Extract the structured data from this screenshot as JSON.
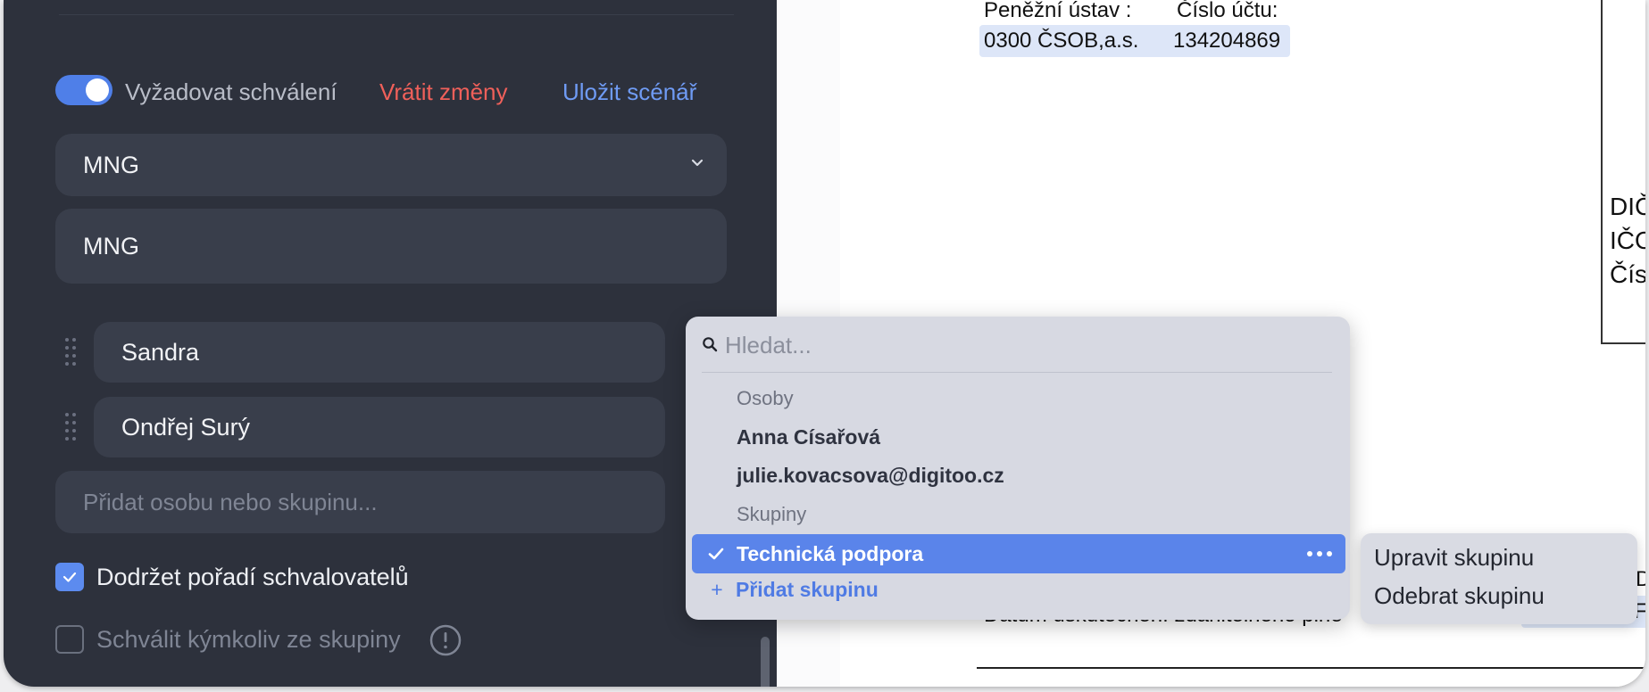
{
  "panel": {
    "toggle_label": "Vyžadovat schválení",
    "revert_label": "Vrátit změny",
    "save_label": "Uložit scénář",
    "select_value": "MNG",
    "name_value": "MNG",
    "approvers": [
      "Sandra",
      "Ondřej Surý"
    ],
    "add_placeholder": "Přidat osobu nebo skupinu...",
    "keep_order_label": "Dodržet pořadí schvalovatelů",
    "keep_order_checked": true,
    "any_from_group_label": "Schválit kýmkoliv ze skupiny",
    "any_from_group_checked": false
  },
  "document": {
    "bank_header": "Peněžní ústav :",
    "account_header": "Číslo účtu:",
    "bank_value": "0300 ČSOB,a.s.",
    "account_value": "134204869",
    "right_labels": [
      "DIČ",
      "IČO",
      "Čís"
    ],
    "bottom_fragment": "Datum uskutečnění zdanitelného plně",
    "right_fragment_1": "D",
    "right_fragment_2": "F"
  },
  "dropdown": {
    "search_placeholder": "Hledat...",
    "people_label": "Osoby",
    "people": [
      "Anna Císařová",
      "julie.kovacsova@digitoo.cz"
    ],
    "groups_label": "Skupiny",
    "selected_group": "Technická podpora",
    "add_group_label": "Přidat skupinu"
  },
  "context_menu": {
    "edit_label": "Upravit skupinu",
    "remove_label": "Odebrat skupinu"
  },
  "colors": {
    "panel_bg": "#2d313c",
    "accent": "#5a84ea",
    "danger": "#f0605a",
    "link": "#6f9bf4"
  }
}
